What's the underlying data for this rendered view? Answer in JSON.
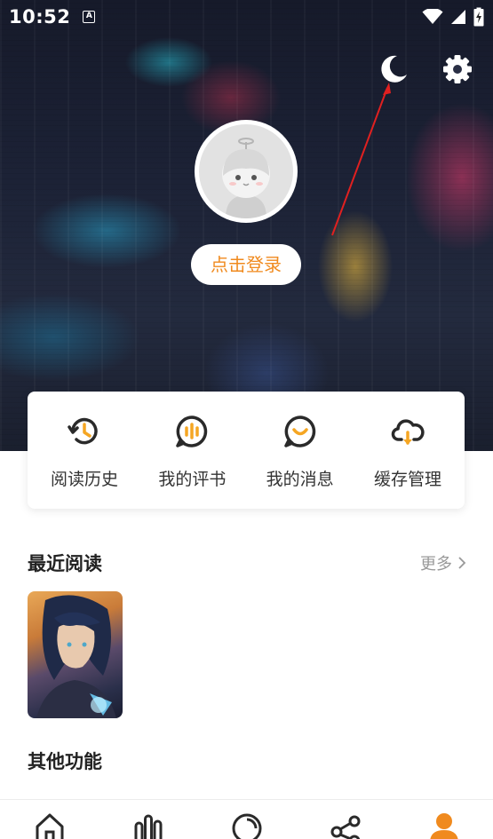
{
  "status_bar": {
    "time": "10:52",
    "badge": "A",
    "icons": [
      "wifi-icon",
      "signal-icon",
      "battery-charging-icon"
    ]
  },
  "header": {
    "icons": [
      "moon-icon",
      "gear-icon"
    ],
    "login_label": "点击登录"
  },
  "functions": [
    {
      "label": "阅读历史",
      "icon": "history-icon"
    },
    {
      "label": "我的评书",
      "icon": "review-icon"
    },
    {
      "label": "我的消息",
      "icon": "message-icon"
    },
    {
      "label": "缓存管理",
      "icon": "cloud-download-icon"
    }
  ],
  "recent": {
    "title": "最近阅读",
    "more_label": "更多"
  },
  "other": {
    "title": "其他功能"
  },
  "bottom_nav": [
    {
      "name": "home",
      "icon": "home-icon"
    },
    {
      "name": "rank",
      "icon": "bars-icon"
    },
    {
      "name": "discover",
      "icon": "circle-icon"
    },
    {
      "name": "share",
      "icon": "share-icon"
    },
    {
      "name": "mine",
      "icon": "user-icon",
      "active": true
    }
  ],
  "colors": {
    "accent": "#f08a1e",
    "icon_dark": "#2a2a2a",
    "history_accent": "#f5a623",
    "review_accent": "#f5a623",
    "nav_active": "#f08a1e",
    "annotation_arrow": "#e02020"
  }
}
